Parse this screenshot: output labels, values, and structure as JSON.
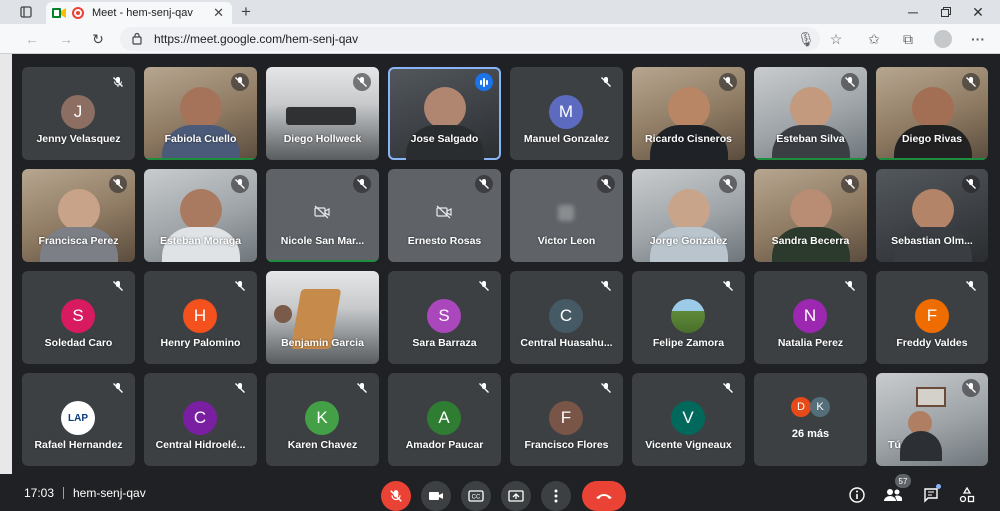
{
  "browser": {
    "tab_title": "Meet - hem-senj-qav",
    "url": "https://meet.google.com/hem-senj-qav"
  },
  "meeting": {
    "time": "17:03",
    "code": "hem-senj-qav",
    "people_count": "57"
  },
  "tiles": {
    "jenny": {
      "name": "Jenny Velasquez",
      "initial": "J",
      "color": "#8d6e63"
    },
    "fabiola": {
      "name": "Fabiola Cuello"
    },
    "diego_h": {
      "name": "Diego Hollweck"
    },
    "jose": {
      "name": "Jose Salgado"
    },
    "manuel": {
      "name": "Manuel Gonzalez",
      "initial": "M",
      "color": "#5c6bc0"
    },
    "ricardo": {
      "name": "Ricardo Cisneros"
    },
    "esteban_s": {
      "name": "Esteban Silva"
    },
    "diego_r": {
      "name": "Diego Rivas"
    },
    "francisca": {
      "name": "Francisca Perez"
    },
    "esteban_m": {
      "name": "Esteban Moraga"
    },
    "nicole": {
      "name": "Nicole San Mar..."
    },
    "ernesto": {
      "name": "Ernesto Rosas"
    },
    "victor": {
      "name": "Victor Leon"
    },
    "jorge": {
      "name": "Jorge Gonzalez"
    },
    "sandra": {
      "name": "Sandra Becerra"
    },
    "sebastian": {
      "name": "Sebastian Olm..."
    },
    "soledad": {
      "name": "Soledad Caro",
      "initial": "S",
      "color": "#d81b60"
    },
    "henry": {
      "name": "Henry Palomino",
      "initial": "H",
      "color": "#f4511e"
    },
    "benjamin": {
      "name": "Benjamin Garcia"
    },
    "sara": {
      "name": "Sara Barraza",
      "initial": "S",
      "color": "#ab47bc"
    },
    "central_h": {
      "name": "Central Huasahu...",
      "initial": "C",
      "color": "#455a64"
    },
    "felipe": {
      "name": "Felipe Zamora"
    },
    "natalia": {
      "name": "Natalia Perez",
      "initial": "N",
      "color": "#9c27b0"
    },
    "freddy": {
      "name": "Freddy Valdes",
      "initial": "F",
      "color": "#ef6c00"
    },
    "rafael": {
      "name": "Rafael Hernandez",
      "logo_text": "LAP"
    },
    "central_hid": {
      "name": "Central Hidroelé...",
      "initial": "C",
      "color": "#7b1fa2"
    },
    "karen": {
      "name": "Karen Chavez",
      "initial": "K",
      "color": "#43a047"
    },
    "amador": {
      "name": "Amador Paucar",
      "initial": "A",
      "color": "#2e7d32"
    },
    "francisco": {
      "name": "Francisco Flores",
      "initial": "F",
      "color": "#795548"
    },
    "vicente": {
      "name": "Vicente Vigneaux",
      "initial": "V",
      "color": "#00695c"
    },
    "more": {
      "label": "26 más",
      "initial_1": "D",
      "color_1": "#e64a19",
      "initial_2": "K",
      "color_2": "#546e7a"
    },
    "self": {
      "name": "Tú"
    }
  }
}
